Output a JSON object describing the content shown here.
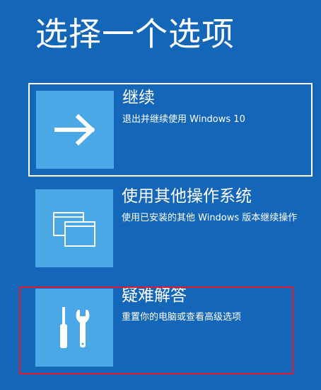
{
  "page": {
    "title": "选择一个选项",
    "background_color": "#1466b8",
    "tile_color": "#4ba8e6",
    "highlight_color": "#e0182d"
  },
  "options": [
    {
      "title": "继续",
      "description": "退出并继续使用 Windows 10",
      "icon": "arrow-right-icon"
    },
    {
      "title": "使用其他操作系统",
      "description": "使用已安装的其他 Windows 版本继续操作",
      "icon": "windows-stack-icon"
    },
    {
      "title": "疑难解答",
      "description": "重置你的电脑或查看高级选项",
      "icon": "tools-icon"
    }
  ]
}
